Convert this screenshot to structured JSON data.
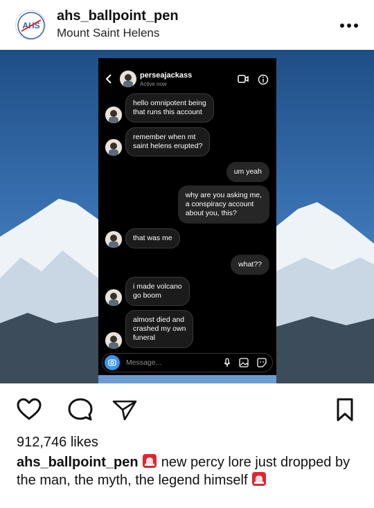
{
  "post": {
    "username": "ahs_ballpoint_pen",
    "location": "Mount Saint Helens",
    "avatar_text": "AHS",
    "likes": "912,746 likes",
    "caption_text_1": "new percy lore just dropped by the man, the myth, the legend himself",
    "accent_red": "#e0262c"
  },
  "dm": {
    "name": "perseajackass",
    "status": "Active now",
    "messages": [
      {
        "from": "them",
        "text": "hello omnipotent being\nthat runs this account"
      },
      {
        "from": "them",
        "text": "remember when mt\nsaint helens erupted?"
      },
      {
        "from": "me",
        "text": "um yeah"
      },
      {
        "from": "me",
        "text": "why are you asking me,\na conspiracy account\nabout you, this?"
      },
      {
        "from": "them",
        "text": "that was me"
      },
      {
        "from": "me",
        "text": "what??"
      },
      {
        "from": "them",
        "text": "i made volcano\ngo boom"
      },
      {
        "from": "them",
        "text": "almost died and\ncrashed my own\nfuneral"
      }
    ],
    "composer_placeholder": "Message..."
  },
  "icons": {
    "more": "more-dots-icon",
    "like": "heart-icon",
    "comment": "comment-icon",
    "share": "send-icon",
    "save": "bookmark-icon",
    "siren": "siren-emoji"
  }
}
